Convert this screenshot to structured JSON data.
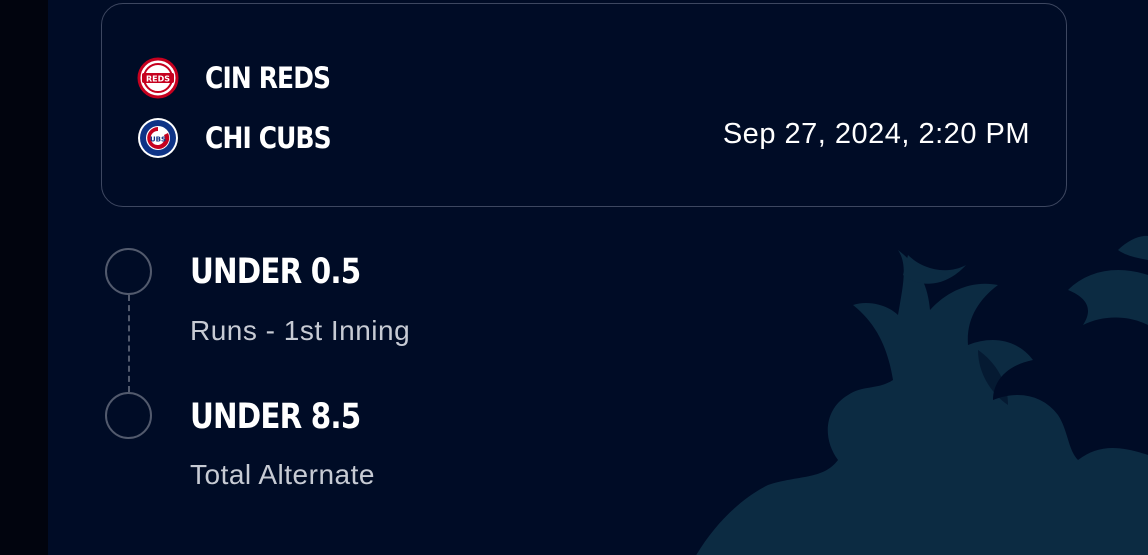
{
  "game": {
    "teams": [
      {
        "name": "CIN REDS",
        "logo": "reds-logo",
        "color": "#c6011f"
      },
      {
        "name": "CHI CUBS",
        "logo": "cubs-logo",
        "color": "#0e3386"
      }
    ],
    "datetime": "Sep 27, 2024, 2:20 PM"
  },
  "legs": [
    {
      "selection": "UNDER 0.5",
      "market": "Runs - 1st Inning"
    },
    {
      "selection": "UNDER 8.5",
      "market": "Total Alternate"
    }
  ],
  "colors": {
    "background": "#000c26",
    "card_border": "#3d4760",
    "watermark": "#0c2b42",
    "text_primary": "#ffffff",
    "text_secondary": "#c7cbd4"
  }
}
